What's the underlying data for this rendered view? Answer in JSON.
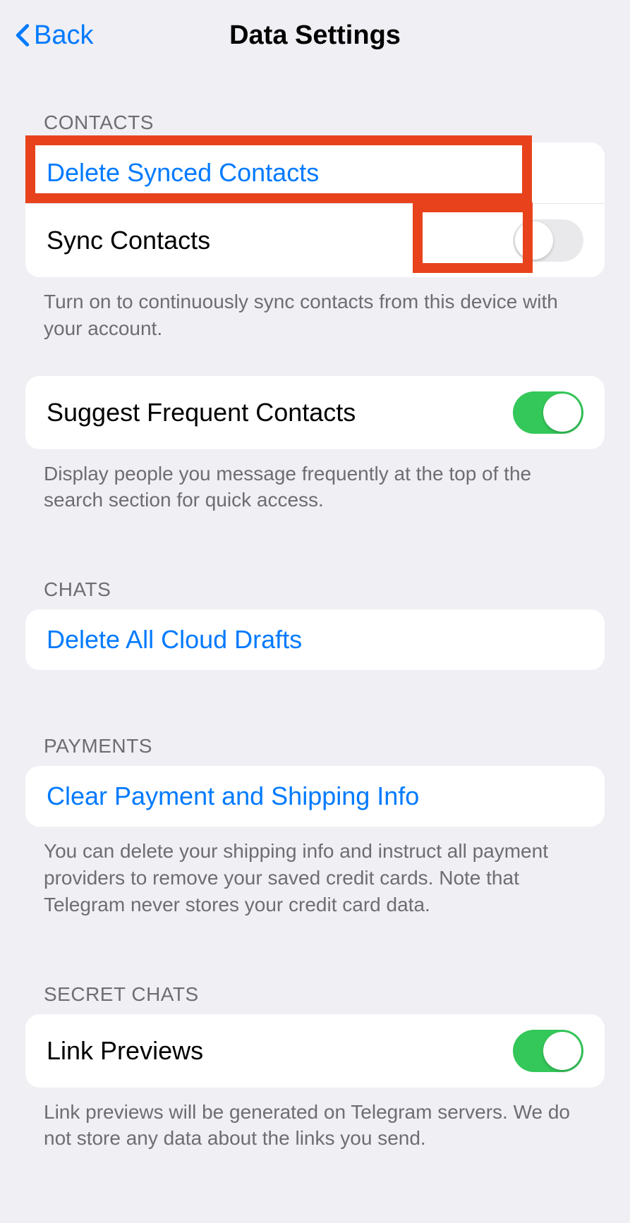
{
  "nav": {
    "back_label": "Back",
    "title": "Data Settings"
  },
  "sections": {
    "contacts": {
      "header": "CONTACTS",
      "delete_synced": "Delete Synced Contacts",
      "sync_contacts": "Sync Contacts",
      "sync_footer": "Turn on to continuously sync contacts from this device with your account.",
      "suggest_frequent": "Suggest Frequent Contacts",
      "suggest_footer": "Display people you message frequently at the top of the search section for quick access."
    },
    "chats": {
      "header": "CHATS",
      "delete_drafts": "Delete All Cloud Drafts"
    },
    "payments": {
      "header": "PAYMENTS",
      "clear_payment": "Clear Payment and Shipping Info",
      "clear_footer": "You can delete your shipping info and instruct all payment providers to remove your saved credit cards. Note that Telegram never stores your credit card data."
    },
    "secret_chats": {
      "header": "SECRET CHATS",
      "link_previews": "Link Previews",
      "link_footer": "Link previews will be generated on Telegram servers. We do not store any data about the links you send."
    }
  },
  "toggles": {
    "sync_contacts": false,
    "suggest_frequent": true,
    "link_previews": true
  }
}
